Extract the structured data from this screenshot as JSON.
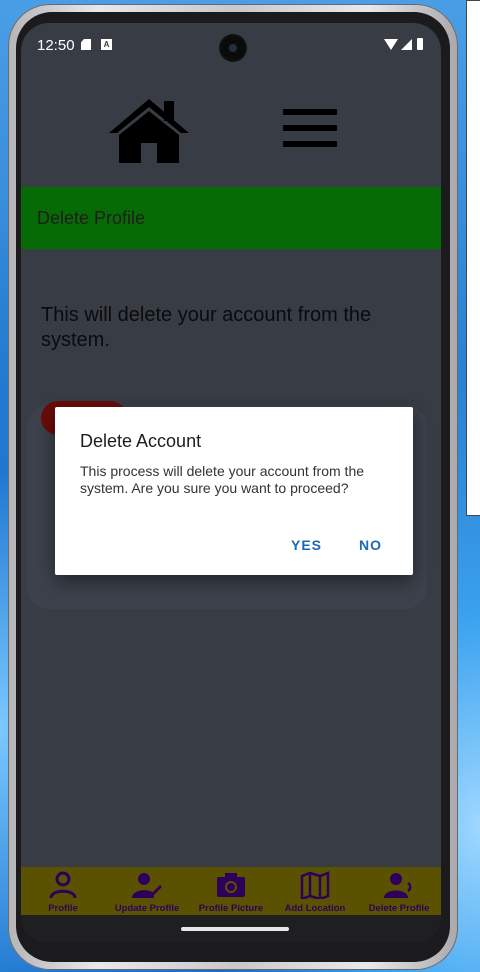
{
  "status_bar": {
    "time": "12:50",
    "sd_icon": "sd-card-icon",
    "a_icon": "a-notification-icon"
  },
  "top_nav": {
    "home_icon": "home-icon",
    "menu_icon": "hamburger-menu-icon"
  },
  "header": {
    "title": "Delete Profile"
  },
  "body": {
    "text": "This will delete your account from the system."
  },
  "dialog": {
    "title": "Delete Account",
    "message": "This process will delete your account from the system.  Are you sure you want to proceed?",
    "yes_label": "YES",
    "no_label": "NO"
  },
  "bottom_nav": {
    "items": [
      {
        "label": "Profile",
        "icon": "person-outline-icon"
      },
      {
        "label": "Update Profile",
        "icon": "person-edit-icon"
      },
      {
        "label": "Profile Picture",
        "icon": "camera-icon"
      },
      {
        "label": "Add Location",
        "icon": "map-icon"
      },
      {
        "label": "Delete Profile",
        "icon": "person-remove-icon"
      }
    ]
  },
  "colors": {
    "header_band": "#076b05",
    "bottom_nav_bg": "#5a5200",
    "nav_icon": "#2e005a",
    "dialog_button": "#1a6ab5"
  }
}
